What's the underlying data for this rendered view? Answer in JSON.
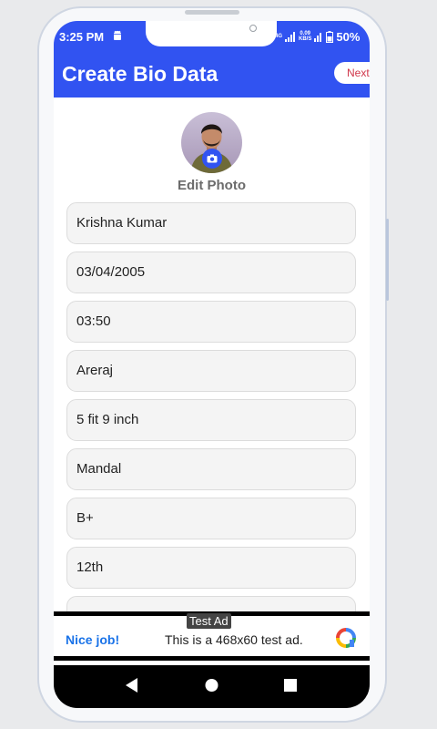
{
  "status": {
    "time": "3:25 PM",
    "network_top": "0.09",
    "network_bottom": "KB/S",
    "signal_label": "4G",
    "battery": "50%"
  },
  "appbar": {
    "title": "Create Bio Data",
    "next_label": "Next"
  },
  "profile": {
    "edit_photo_label": "Edit Photo"
  },
  "form": {
    "fields": [
      {
        "value": "Krishna Kumar"
      },
      {
        "value": "03/04/2005"
      },
      {
        "value": "03:50"
      },
      {
        "value": "Areraj"
      },
      {
        "value": "5 fit 9 inch"
      },
      {
        "value": "Mandal"
      },
      {
        "value": "B+"
      },
      {
        "value": "12th"
      },
      {
        "value": ""
      }
    ]
  },
  "ad": {
    "label": "Test Ad",
    "nice": "Nice job!",
    "text": "This is a 468x60 test ad."
  },
  "colors": {
    "primary": "#3153f1",
    "next_text": "#d0364a",
    "field_bg": "#f4f4f4"
  }
}
